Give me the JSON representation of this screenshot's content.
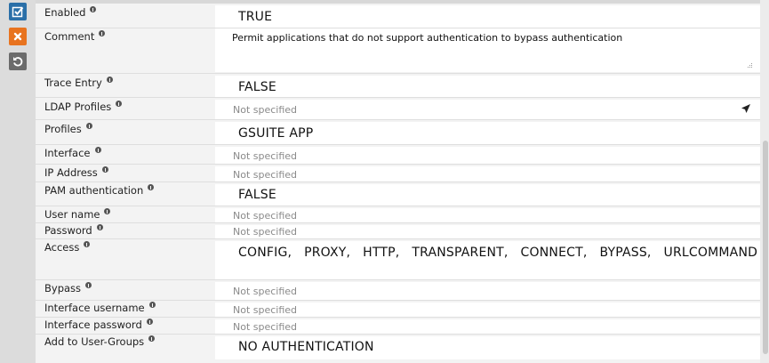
{
  "toolbar": {
    "save_icon": "checkbox-check-icon",
    "cancel_icon": "close-x-icon",
    "reset_icon": "undo-icon",
    "colors": {
      "save": "#2a6fa8",
      "cancel": "#e8731f",
      "reset": "#6b6b6b"
    }
  },
  "rows": [
    {
      "label": "Enabled",
      "value": "TRUE"
    },
    {
      "label": "Comment",
      "value": "Permit applications that do not support authentication to bypass authentication"
    },
    {
      "label": "Trace Entry",
      "value": "FALSE"
    },
    {
      "label": "LDAP Profiles",
      "placeholder": "Not specified"
    },
    {
      "label": "Profiles",
      "value": "GSUITE APP"
    },
    {
      "label": "Interface",
      "placeholder": "Not specified"
    },
    {
      "label": "IP Address",
      "placeholder": "Not specified"
    },
    {
      "label": "PAM authentication",
      "value": "FALSE"
    },
    {
      "label": "User name",
      "placeholder": "Not specified"
    },
    {
      "label": "Password",
      "placeholder": "Not specified"
    },
    {
      "label": "Access",
      "value": "CONFIG,   PROXY,   HTTP,   TRANSPARENT,   CONNECT,   BYPASS,   URLCOMMAND"
    },
    {
      "label": "Bypass",
      "placeholder": "Not specified"
    },
    {
      "label": "Interface username",
      "placeholder": "Not specified"
    },
    {
      "label": "Interface password",
      "placeholder": "Not specified"
    },
    {
      "label": "Add to User-Groups",
      "value": "NO AUTHENTICATION"
    }
  ]
}
